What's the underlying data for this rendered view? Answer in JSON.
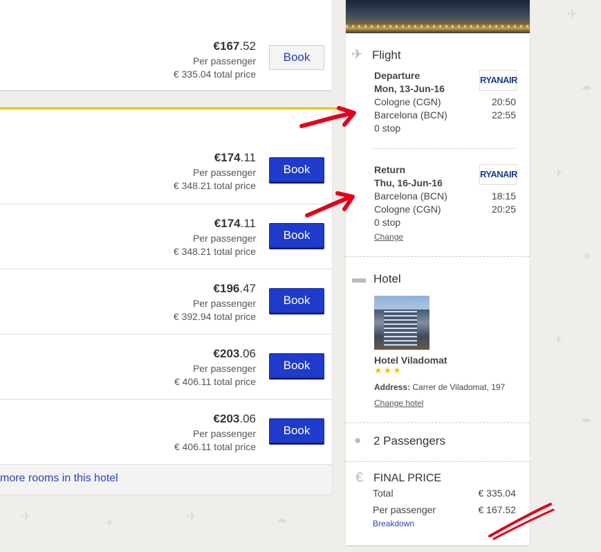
{
  "results": {
    "top_card": {
      "price_int": "€167",
      "price_dec": ".52",
      "per": "Per passenger",
      "total": "€ 335.04 total price",
      "book": "Book"
    },
    "rows": [
      {
        "price_int": "€174",
        "price_dec": ".11",
        "per": "Per passenger",
        "total": "€ 348.21 total price",
        "book": "Book"
      },
      {
        "price_int": "€174",
        "price_dec": ".11",
        "per": "Per passenger",
        "total": "€ 348.21 total price",
        "book": "Book"
      },
      {
        "price_int": "€196",
        "price_dec": ".47",
        "per": "Per passenger",
        "total": "€ 392.94 total price",
        "book": "Book"
      },
      {
        "price_int": "€203",
        "price_dec": ".06",
        "per": "Per passenger",
        "total": "€ 406.11 total price",
        "book": "Book"
      },
      {
        "price_int": "€203",
        "price_dec": ".06",
        "per": "Per passenger",
        "total": "€ 406.11 total price",
        "book": "Book"
      }
    ],
    "more_rooms": "more rooms in this hotel"
  },
  "sidebar": {
    "flight": {
      "title": "Flight",
      "icon": "plane-icon",
      "departure": {
        "label": "Departure",
        "date": "Mon, 13-Jun-16",
        "from": "Cologne (CGN)",
        "from_time": "20:50",
        "to": "Barcelona (BCN)",
        "to_time": "22:55",
        "stops": "0 stop",
        "airline": "RYANAIR"
      },
      "return": {
        "label": "Return",
        "date": "Thu, 16-Jun-16",
        "from": "Barcelona (BCN)",
        "from_time": "18:15",
        "to": "Cologne (CGN)",
        "to_time": "20:25",
        "stops": "0 stop",
        "airline": "RYANAIR"
      },
      "change": "Change"
    },
    "hotel": {
      "title": "Hotel",
      "icon": "bed-icon",
      "name": "Hotel Viladomat",
      "stars": "★★★",
      "address_label": "Address:",
      "address": "Carrer de Viladomat, 197",
      "change": "Change hotel"
    },
    "passengers": {
      "title": "2 Passengers",
      "icon": "person-icon"
    },
    "final": {
      "title": "FINAL PRICE",
      "icon": "euro-icon",
      "total_label": "Total",
      "total_value": "€ 335.04",
      "per_label": "Per passenger",
      "per_value": "€ 167.52",
      "breakdown": "Breakdown"
    }
  },
  "colors": {
    "accent": "#1f3bcc",
    "highlight": "#f2c300",
    "annotation": "#e3001b"
  }
}
